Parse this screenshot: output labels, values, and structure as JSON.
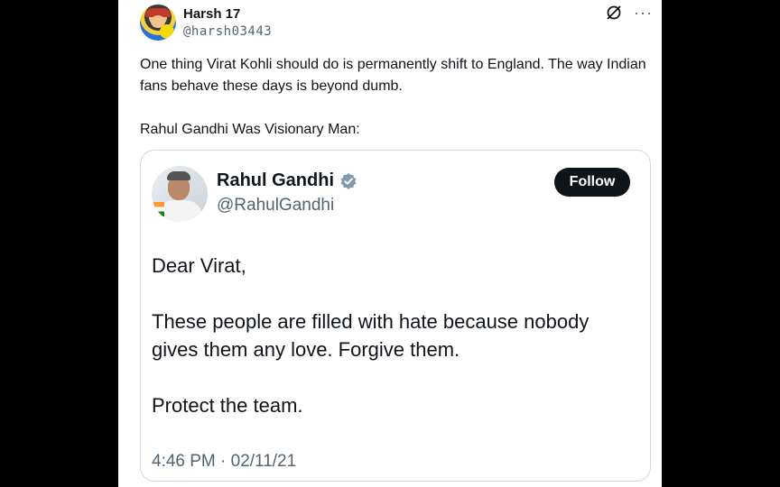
{
  "tweet": {
    "author_name": "Harsh 17",
    "author_handle": "@harsh03443",
    "text_line1": "One thing Virat Kohli should do is permanently shift to England. The way Indian fans behave these days is beyond dumb.",
    "text_line2": "Rahul Gandhi Was Visionary Man:",
    "more_label": "···"
  },
  "quoted": {
    "author_name": "Rahul Gandhi",
    "author_handle": "@RahulGandhi",
    "follow_label": "Follow",
    "paragraph1": "Dear Virat,",
    "paragraph2": "These people are filled with hate because nobody gives them any love. Forgive them.",
    "paragraph3": "Protect the team.",
    "timestamp": "4:46 PM · 02/11/21"
  },
  "colors": {
    "verified_badge": "#829aab",
    "muted_text": "#536471"
  }
}
